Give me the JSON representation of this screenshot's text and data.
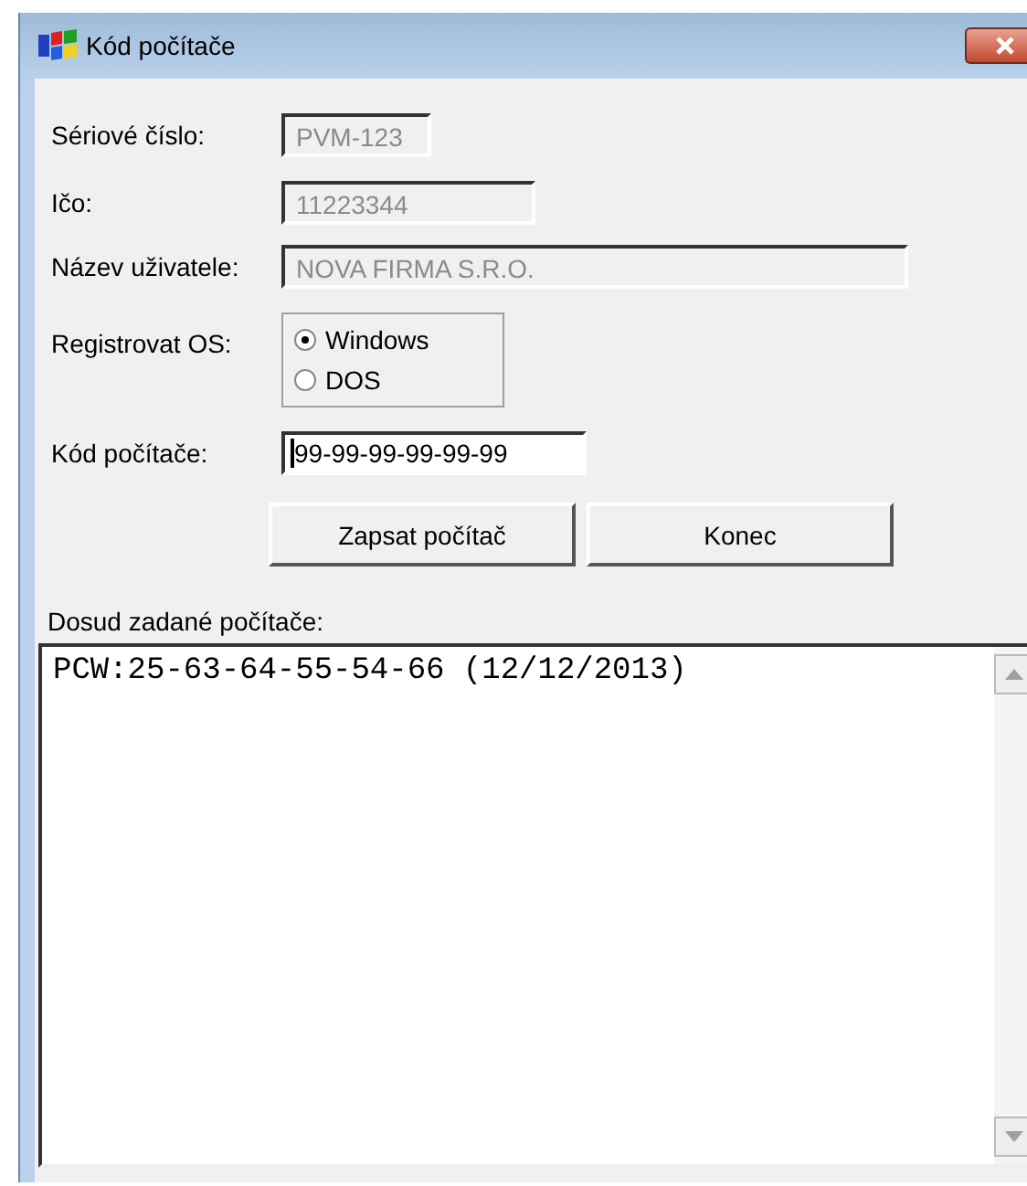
{
  "window": {
    "title": "Kód počítače"
  },
  "fields": [
    {
      "label": "Sériové číslo:",
      "value": "PVM-123",
      "disabled": true
    },
    {
      "label": "Ičo:",
      "value": "11223344",
      "disabled": true
    },
    {
      "label": "Název uživatele:",
      "value": "NOVA FIRMA S.R.O.",
      "disabled": true
    }
  ],
  "os": {
    "label": "Registrovat OS:",
    "options": [
      {
        "label": "Windows",
        "selected": true
      },
      {
        "label": "DOS",
        "selected": false
      }
    ]
  },
  "code": {
    "label": "Kód počítače:",
    "value": "99-99-99-99-99-99"
  },
  "buttons": [
    "Zapsat počítač",
    "Konec"
  ],
  "list": {
    "label": "Dosud zadané počítače:",
    "lines": [
      "PCW:25-63-64-55-54-66 (12/12/2013)"
    ]
  }
}
